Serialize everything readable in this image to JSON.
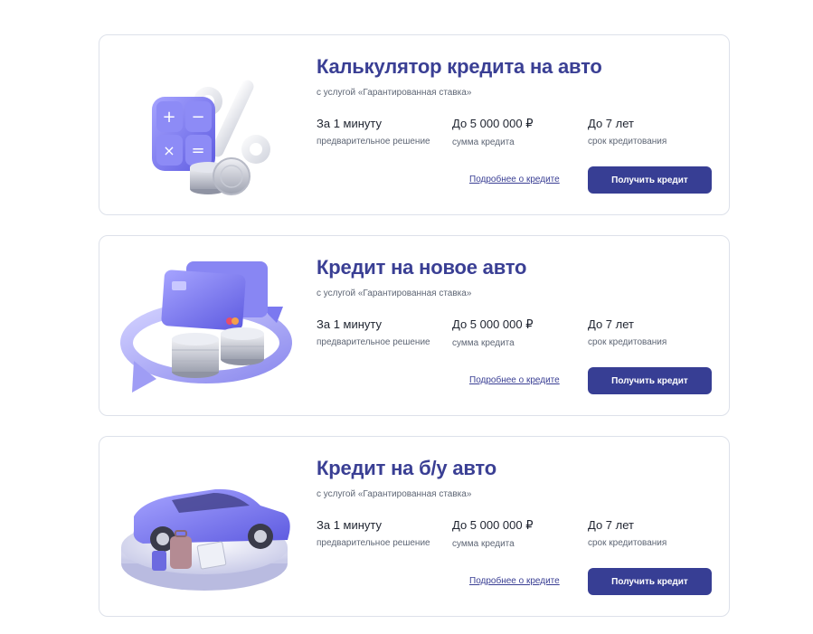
{
  "cards": [
    {
      "title": "Калькулятор кредита на авто",
      "subtitle": "с услугой «Гарантированная ставка»",
      "features": [
        {
          "value": "За 1 минуту",
          "label": "предварительное решение"
        },
        {
          "value": "До 5 000 000 ₽",
          "label": "сумма кредита"
        },
        {
          "value": "До 7 лет",
          "label": "срок кредитования"
        }
      ],
      "link_label": "Подробнее о кредите",
      "button_label": "Получить кредит",
      "illustration": "calculator-percent-coins"
    },
    {
      "title": "Кредит на новое авто",
      "subtitle": "с услугой «Гарантированная ставка»",
      "features": [
        {
          "value": "За 1 минуту",
          "label": "предварительное решение"
        },
        {
          "value": "До 5 000 000 ₽",
          "label": "сумма кредита"
        },
        {
          "value": "До 7 лет",
          "label": "срок кредитования"
        }
      ],
      "link_label": "Подробнее о кредите",
      "button_label": "Получить кредит",
      "illustration": "cards-coins-arrows"
    },
    {
      "title": "Кредит на б/у авто",
      "subtitle": "с услугой «Гарантированная ставка»",
      "features": [
        {
          "value": "За 1 минуту",
          "label": "предварительное решение"
        },
        {
          "value": "До 5 000 000 ₽",
          "label": "сумма кредита"
        },
        {
          "value": "До 7 лет",
          "label": "срок кредитования"
        }
      ],
      "link_label": "Подробнее о кредите",
      "button_label": "Получить кредит",
      "illustration": "car-on-podium"
    }
  ],
  "colors": {
    "accent": "#3a3f94",
    "button": "#373e94",
    "illustration_purple": "#7b79f0",
    "border": "#dde1ea"
  }
}
